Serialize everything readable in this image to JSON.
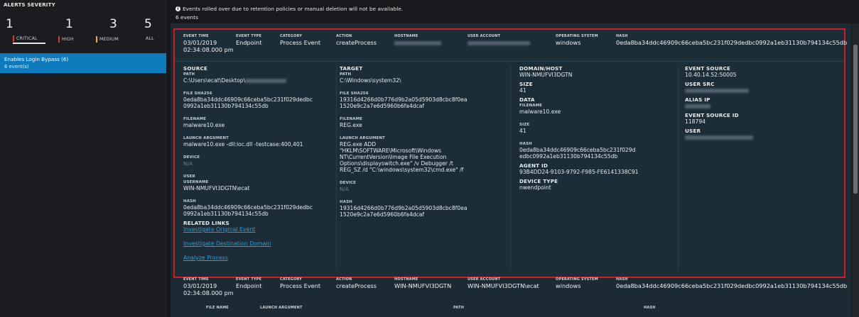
{
  "sidebar": {
    "title": "ALERTS SEVERITY",
    "severities": [
      {
        "count": "1",
        "label": "CRITICAL",
        "color": "#e0362f"
      },
      {
        "count": "1",
        "label": "HIGH",
        "color": "#e0362f"
      },
      {
        "count": "3",
        "label": "MEDIUM",
        "color": "#f2b515"
      },
      {
        "count": "5",
        "label": "ALL",
        "color": ""
      }
    ],
    "alert": {
      "title": "Enables Login Bypass (6)",
      "subtitle": "6 event(s)"
    }
  },
  "main": {
    "notice": "Events rolled over due to retention policies or manual deletion will not be available.",
    "event_count": "6 events"
  },
  "header_labels": {
    "event_time": "EVENT TIME",
    "event_type": "EVENT TYPE",
    "category": "CATEGORY",
    "action": "ACTION",
    "hostname": "HOSTNAME",
    "user_account": "USER ACCOUNT",
    "os": "OPERATING SYSTEM",
    "hash": "HASH"
  },
  "event1": {
    "header": {
      "event_time_date": "03/01/2019",
      "event_time_clock": "02:34:08.000 pm",
      "event_type": "Endpoint",
      "category": "Process Event",
      "action": "createProcess",
      "os": "windows",
      "hash": "0eda8ba34ddc46909c66ceba5bc231f029dedbc0992a1eb31130b794134c55db"
    },
    "source": {
      "title": "SOURCE",
      "path_label": "PATH",
      "path": "C:\\Users\\ecat\\Desktop\\",
      "sha_label": "FILE SHA256",
      "sha_line1": "0eda8ba34ddc46909c66ceba5bc231f029dedbc",
      "sha_line2": "0992a1eb31130b794134c55db",
      "filename_label": "FILENAME",
      "filename": "malware10.exe",
      "launch_label": "LAUNCH ARGUMENT",
      "launch": "malware10.exe -dll:ioc.dll -testcase:400,401",
      "device_label": "DEVICE",
      "device": "N/A",
      "user_label": "USER",
      "username_label": "USERNAME",
      "username": "WIN-NMUFVI3DGTN\\ecat",
      "hash_label": "HASH",
      "hash_line1": "0eda8ba34ddc46909c66ceba5bc231f029dedbc",
      "hash_line2": "0992a1eb31130b794134c55db",
      "related_title": "RELATED LINKS",
      "link1": "Investigate Original Event",
      "link2": "Investigate Destination Domain",
      "link3": "Analyze Process"
    },
    "target": {
      "title": "TARGET",
      "path_label": "PATH",
      "path": "C:\\Windows\\system32\\",
      "sha_label": "FILE SHA256",
      "sha_line1": "19316d4266d0b776d9b2a05d5903d8cbc8f0ea",
      "sha_line2": "1520e9c2a7e6d5960b6fa4dcaf",
      "filename_label": "FILENAME",
      "filename": "REG.exe",
      "launch_label": "LAUNCH ARGUMENT",
      "launch_line1": "REG.exe ADD",
      "launch_line2": "\"HKLM\\SOFTWARE\\Microsoft\\Windows",
      "launch_line3": "NT\\CurrentVersion\\Image File Execution",
      "launch_line4": "Options\\displayswitch.exe\" /v Debugger /t",
      "launch_line5": "REG_SZ /d \"C:\\windows\\system32\\cmd.exe\" /f",
      "device_label": "DEVICE",
      "device": "N/A",
      "hash_label": "HASH",
      "hash_line1": "19316d4266d0b776d9b2a05d5903d8cbc8f0ea",
      "hash_line2": "1520e9c2a7e6d5960b6fa4dcaf"
    },
    "domain": {
      "title": "DOMAIN/HOST",
      "host": "WIN-NMUFVI3DGTN",
      "size_label": "SIZE",
      "size": "41",
      "data_title": "DATA",
      "filename_label": "FILENAME",
      "filename": "malware10.exe",
      "size2_label": "SIZE",
      "size2": "41",
      "hash_label": "HASH",
      "hash_line1": "0eda8ba34ddc46909c66ceba5bc231f029d",
      "hash_line2": "edbc0992a1eb31130b794134c55db",
      "agent_label": "AGENT ID",
      "agent": "93B4DD24-9103-9792-F985-FE6141338C91",
      "device_type_label": "DEVICE TYPE",
      "device_type": "nwendpoint"
    },
    "evsource": {
      "title": "EVENT SOURCE",
      "value": "10.40.14.52:50005",
      "user_src_label": "USER SRC",
      "alias_label": "ALIAS IP",
      "source_id_label": "EVENT SOURCE ID",
      "source_id": "118794",
      "user_label": "USER"
    }
  },
  "event2": {
    "header": {
      "event_time_date": "03/01/2019",
      "event_time_clock": "02:34:08.000 pm",
      "event_type": "Endpoint",
      "category": "Process Event",
      "action": "createProcess",
      "hostname": "WIN-NMUFVI3DGTN",
      "user_account": "WIN-NMUFVI3DGTN\\ecat",
      "os": "windows",
      "hash": "0eda8ba34ddc46909c66ceba5bc231f029dedbc0992a1eb31130b794134c55db"
    },
    "subhead": {
      "file_name": "FILE NAME",
      "launch_argument": "LAUNCH ARGUMENT",
      "path": "PATH",
      "hash": "HASH"
    }
  }
}
